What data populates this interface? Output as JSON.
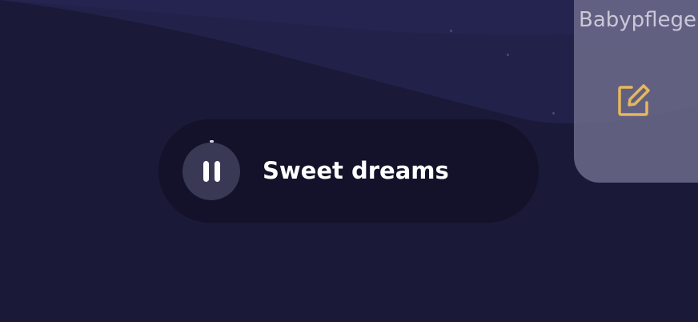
{
  "player": {
    "title": "Sweet dreams",
    "state_icon": "pause-icon"
  },
  "side_panel": {
    "label": "Babypflege",
    "action_icon": "edit-icon",
    "action_icon_color": "#e6b85c"
  },
  "colors": {
    "background": "#1a1937",
    "pill": "#13122a",
    "pause_button": "#3a3955",
    "panel": "#706e8d"
  }
}
